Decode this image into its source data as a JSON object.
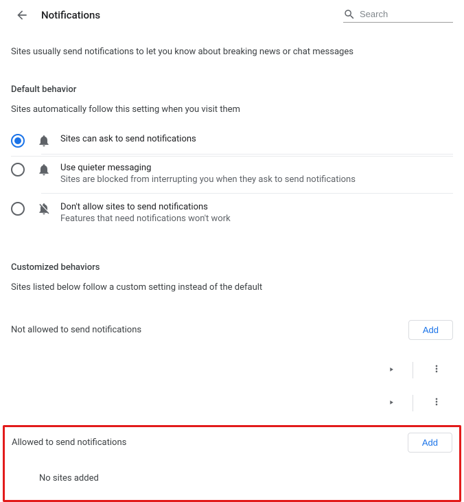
{
  "header": {
    "title": "Notifications",
    "search_placeholder": "Search"
  },
  "intro": "Sites usually send notifications to let you know about breaking news or chat messages",
  "default_behavior": {
    "title": "Default behavior",
    "subtitle": "Sites automatically follow this setting when you visit them",
    "options": [
      {
        "label": "Sites can ask to send notifications",
        "description": "",
        "selected": true
      },
      {
        "label": "Use quieter messaging",
        "description": "Sites are blocked from interrupting you when they ask to send notifications",
        "selected": false
      },
      {
        "label": "Don't allow sites to send notifications",
        "description": "Features that need notifications won't work",
        "selected": false
      }
    ]
  },
  "customized": {
    "title": "Customized behaviors",
    "subtitle": "Sites listed below follow a custom setting instead of the default"
  },
  "not_allowed": {
    "label": "Not allowed to send notifications",
    "add_button": "Add"
  },
  "allowed": {
    "label": "Allowed to send notifications",
    "add_button": "Add",
    "empty": "No sites added"
  }
}
